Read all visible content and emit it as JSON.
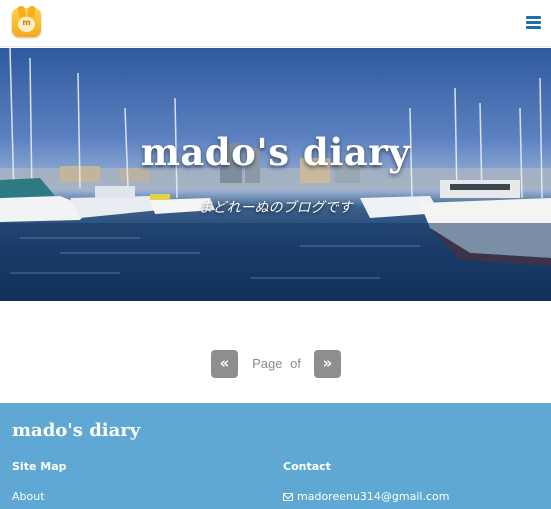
{
  "header": {
    "logo_alt": "m",
    "menu_icon": "hamburger-menu-icon"
  },
  "hero": {
    "title": "mado's diary",
    "subtitle": "まどれーぬのブログです"
  },
  "pager": {
    "prev_icon": "«",
    "next_icon": "»",
    "page_word": "Page",
    "of_word": "of"
  },
  "footer": {
    "title": "mado's diary",
    "sitemap_heading": "Site Map",
    "contact_heading": "Contact",
    "about_link": "About",
    "email": "madoreenu314@gmail.com"
  },
  "colors": {
    "accent": "#1f6ea8",
    "footer_bg": "#5fa8d3",
    "pager_button": "#8e8e8e"
  }
}
